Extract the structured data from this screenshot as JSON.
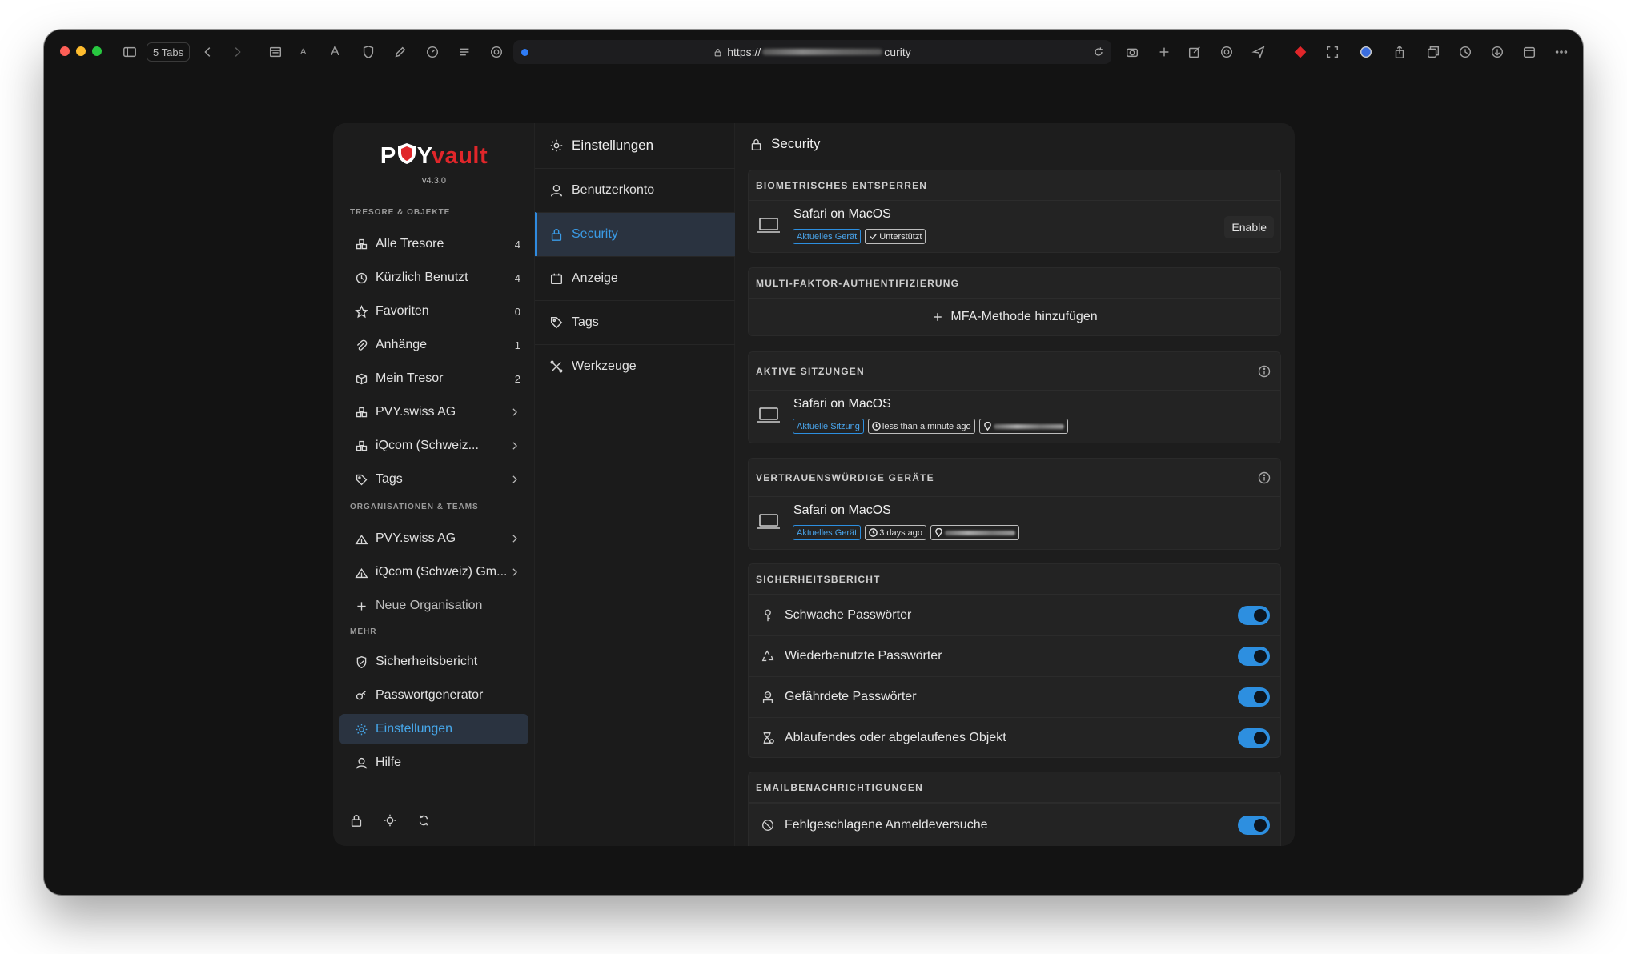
{
  "browser": {
    "tabs_label": "5 Tabs",
    "url_prefix": "https://",
    "url_suffix": "curity"
  },
  "app": {
    "logo_pvy": "P",
    "logo_y": "Y",
    "logo_vault": "vault",
    "version": "v4.3.0"
  },
  "sidebar": {
    "section_vaults": "TRESORE & OBJEKTE",
    "items": [
      {
        "label": "Alle Tresore",
        "count": "4"
      },
      {
        "label": "Kürzlich Benutzt",
        "count": "4"
      },
      {
        "label": "Favoriten",
        "count": "0"
      },
      {
        "label": "Anhänge",
        "count": "1"
      },
      {
        "label": "Mein Tresor",
        "count": "2"
      },
      {
        "label": "PVY.swiss AG"
      },
      {
        "label": "iQcom (Schweiz..."
      },
      {
        "label": "Tags"
      }
    ],
    "section_orgs": "ORGANISATIONEN & TEAMS",
    "orgs": [
      {
        "label": "PVY.swiss AG"
      },
      {
        "label": "iQcom (Schweiz) Gm..."
      },
      {
        "label": "Neue Organisation"
      }
    ],
    "section_more": "MEHR",
    "more": [
      {
        "label": "Sicherheitsbericht"
      },
      {
        "label": "Passwortgenerator"
      },
      {
        "label": "Einstellungen"
      },
      {
        "label": "Hilfe"
      }
    ]
  },
  "settings_menu": {
    "title": "Einstellungen",
    "items": [
      {
        "label": "Benutzerkonto"
      },
      {
        "label": "Security"
      },
      {
        "label": "Anzeige"
      },
      {
        "label": "Tags"
      },
      {
        "label": "Werkzeuge"
      }
    ]
  },
  "content": {
    "title": "Security",
    "biometric": {
      "title": "BIOMETRISCHES ENTSPERREN",
      "device": "Safari on MacOS",
      "badge_current": "Aktuelles Gerät",
      "badge_supported": "Unterstützt",
      "button": "Enable"
    },
    "mfa": {
      "title": "MULTI-FAKTOR-AUTHENTIFIZIERUNG",
      "add": "MFA-Methode hinzufügen"
    },
    "sessions": {
      "title": "AKTIVE SITZUNGEN",
      "device": "Safari on MacOS",
      "badge_current": "Aktuelle Sitzung",
      "time": "less than a minute ago"
    },
    "trusted": {
      "title": "VERTRAUENSWÜRDIGE GERÄTE",
      "device": "Safari on MacOS",
      "badge_current": "Aktuelles Gerät",
      "time": "3 days ago"
    },
    "report": {
      "title": "SICHERHEITSBERICHT",
      "items": [
        {
          "label": "Schwache Passwörter",
          "enabled": true
        },
        {
          "label": "Wiederbenutzte Passwörter",
          "enabled": true
        },
        {
          "label": "Gefährdete Passwörter",
          "enabled": true
        },
        {
          "label": "Ablaufendes oder abgelaufenes Objekt",
          "enabled": true
        }
      ]
    },
    "email": {
      "title": "EMAILBENACHRICHTIGUNGEN",
      "items": [
        {
          "label": "Fehlgeschlagene Anmeldeversuche",
          "enabled": true
        }
      ]
    }
  },
  "colors": {
    "accent": "#2d8fe0",
    "brand_red": "#e0262a",
    "background": "#131313"
  }
}
